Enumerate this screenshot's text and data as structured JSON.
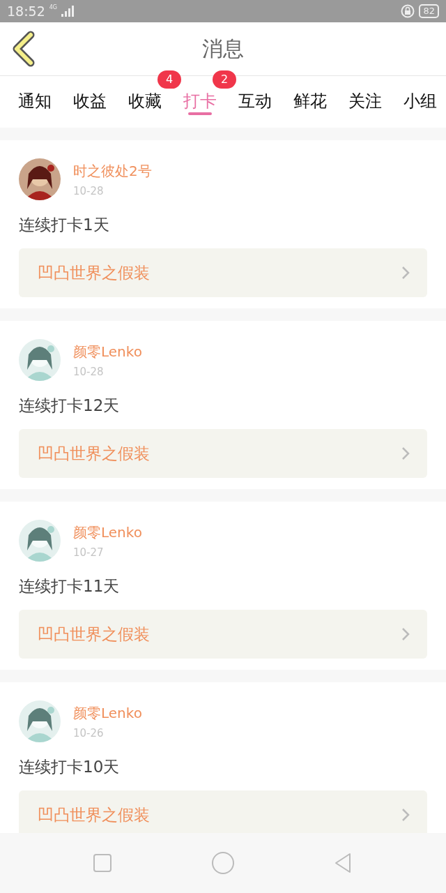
{
  "status_bar": {
    "time": "18:52",
    "network": "4G",
    "battery": "82"
  },
  "header": {
    "title": "消息"
  },
  "tabs": [
    {
      "label": "通知",
      "selected": false
    },
    {
      "label": "收益",
      "selected": false
    },
    {
      "label": "收藏",
      "selected": false,
      "badge": "4"
    },
    {
      "label": "打卡",
      "selected": true,
      "badge": "2"
    },
    {
      "label": "互动",
      "selected": false
    },
    {
      "label": "鲜花",
      "selected": false
    },
    {
      "label": "关注",
      "selected": false
    },
    {
      "label": "小组",
      "selected": false
    }
  ],
  "messages": [
    {
      "user": "时之彼处2号",
      "date": "10-28",
      "text": "连续打卡1天",
      "topic": "凹凸世界之假装"
    },
    {
      "user": "颜零Lenko",
      "date": "10-28",
      "text": "连续打卡12天",
      "topic": "凹凸世界之假装"
    },
    {
      "user": "颜零Lenko",
      "date": "10-27",
      "text": "连续打卡11天",
      "topic": "凹凸世界之假装"
    },
    {
      "user": "颜零Lenko",
      "date": "10-26",
      "text": "连续打卡10天",
      "topic": "凹凸世界之假装"
    }
  ]
}
